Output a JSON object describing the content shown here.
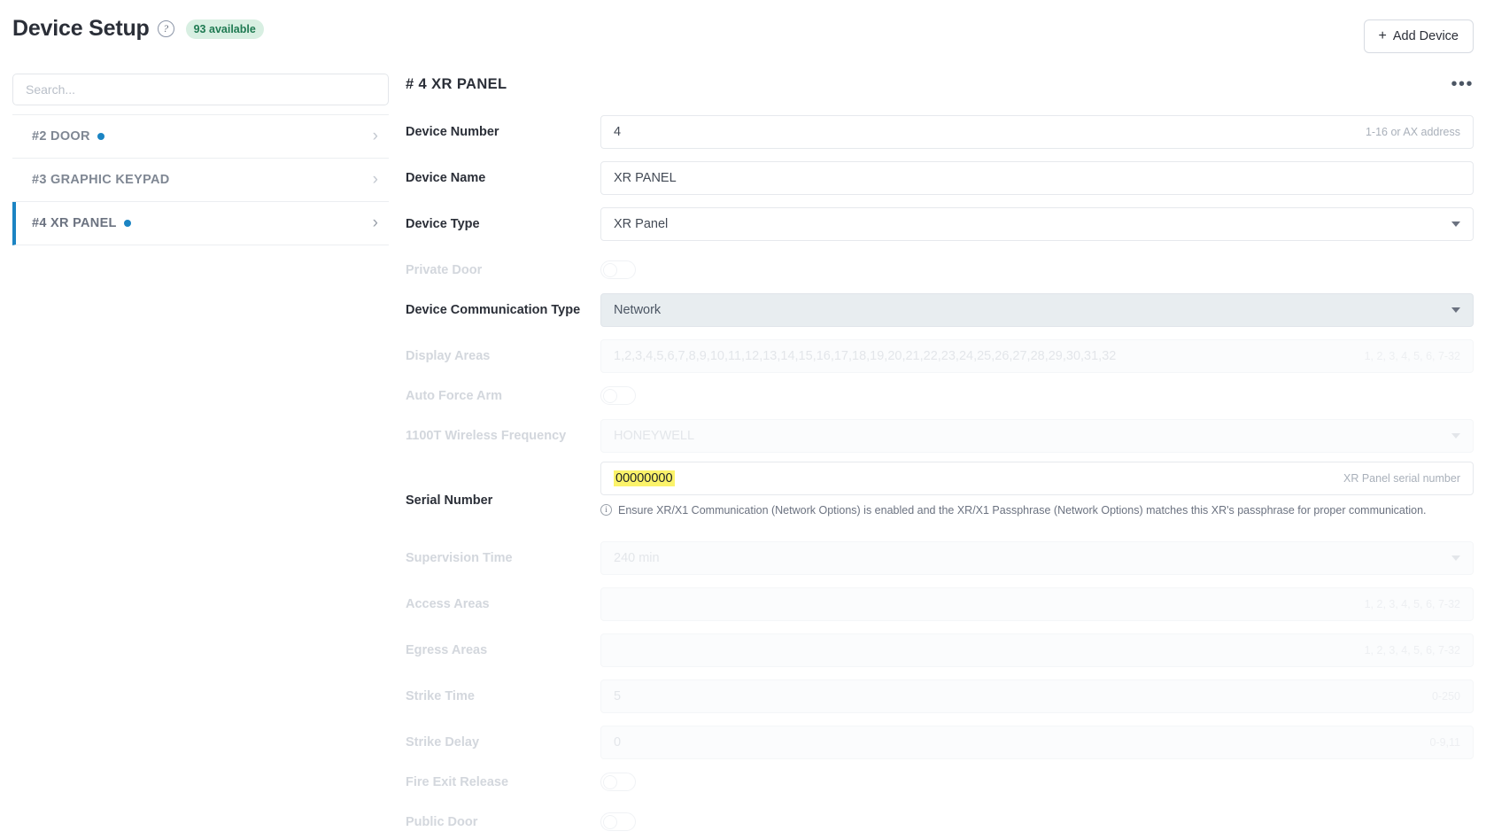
{
  "header": {
    "title": "Device Setup",
    "help_icon": "question-mark-icon",
    "availability_badge": "93 available",
    "add_device_label": "Add Device",
    "add_device_plus": "+"
  },
  "sidebar": {
    "search_placeholder": "Search...",
    "search_value": "",
    "items": [
      {
        "label": "#2 DOOR",
        "has_status_dot": true,
        "selected": false,
        "chevron": "›"
      },
      {
        "label": "#3 GRAPHIC KEYPAD",
        "has_status_dot": false,
        "selected": false,
        "chevron": "›"
      },
      {
        "label": "#4 XR PANEL",
        "has_status_dot": true,
        "selected": true,
        "chevron": "›"
      }
    ]
  },
  "panel": {
    "title": "# 4 XR PANEL",
    "kebab": "•••",
    "fields": {
      "device_number": {
        "label": "Device Number",
        "value": "4",
        "hint": "1-16 or AX address"
      },
      "device_name": {
        "label": "Device Name",
        "value": "XR PANEL",
        "hint": ""
      },
      "device_type": {
        "label": "Device Type",
        "value": "XR Panel",
        "hint": ""
      },
      "private_door": {
        "label": "Private Door",
        "value": "off"
      },
      "device_communication_type": {
        "label": "Device Communication Type",
        "value": "Network",
        "hint": ""
      },
      "display_areas": {
        "label": "Display Areas",
        "value": "1,2,3,4,5,6,7,8,9,10,11,12,13,14,15,16,17,18,19,20,21,22,23,24,25,26,27,28,29,30,31,32",
        "hint": "1, 2, 3, 4, 5, 6, 7-32"
      },
      "auto_force_arm": {
        "label": "Auto Force Arm",
        "value": "off"
      },
      "wireless_frequency": {
        "label": "1100T Wireless Frequency",
        "value": "HONEYWELL",
        "hint": ""
      },
      "serial_number": {
        "label": "Serial Number",
        "value": "00000000",
        "hint": "XR Panel serial number",
        "note": "Ensure XR/X1 Communication (Network Options) is enabled and the XR/X1 Passphrase (Network Options) matches this XR's passphrase for proper communication."
      },
      "supervision_time": {
        "label": "Supervision Time",
        "value": "240 min",
        "hint": ""
      },
      "access_areas": {
        "label": "Access Areas",
        "value": "",
        "hint": "1, 2, 3, 4, 5, 6, 7-32"
      },
      "egress_areas": {
        "label": "Egress Areas",
        "value": "",
        "hint": "1, 2, 3, 4, 5, 6, 7-32"
      },
      "strike_time": {
        "label": "Strike Time",
        "value": "5",
        "hint": "0-250"
      },
      "strike_delay": {
        "label": "Strike Delay",
        "value": "0",
        "hint": "0-9,11"
      },
      "fire_exit_release": {
        "label": "Fire Exit Release",
        "value": "off"
      },
      "public_door": {
        "label": "Public Door",
        "value": "off"
      }
    }
  },
  "colors": {
    "accent_blue": "#1b84c3",
    "badge_bg": "#d8efe2",
    "badge_text": "#1f7a52",
    "highlight_yellow": "#fbf36a",
    "focus_gray": "#e8edf0"
  }
}
